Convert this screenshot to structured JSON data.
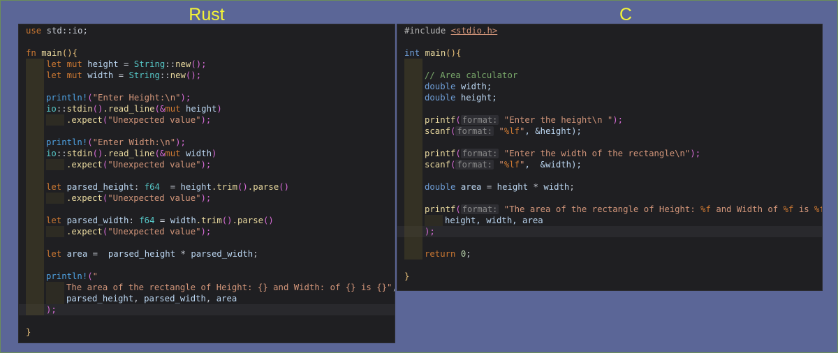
{
  "titles": {
    "rust": "Rust",
    "c": "C"
  },
  "rust": {
    "l1": {
      "a": "use",
      "b": " std::io;"
    },
    "l3": {
      "a": "fn",
      "b": " main",
      "c": "()",
      "d": "{"
    },
    "l4": {
      "a": "let mut",
      "b": " height",
      "c": " = ",
      "d": "String",
      "e": "::",
      "f": "new",
      "g": "();"
    },
    "l5": {
      "a": "let mut",
      "b": " width",
      "c": " = ",
      "d": "String",
      "e": "::",
      "f": "new",
      "g": "();"
    },
    "l7": {
      "a": "println!",
      "b": "(",
      "c": "\"Enter Height:\\n\"",
      "d": ");"
    },
    "l8": {
      "a": "io",
      "b": "::",
      "c": "stdin",
      "d": "()",
      "e": ".read_line",
      "f": "(&",
      "g": "mut",
      "h": " height",
      "i": ")"
    },
    "l9": {
      "a": ".expect",
      "b": "(",
      "c": "\"Unexpected value\"",
      "d": ");"
    },
    "l11": {
      "a": "println!",
      "b": "(",
      "c": "\"Enter Width:\\n\"",
      "d": ");"
    },
    "l12": {
      "a": "io",
      "b": "::",
      "c": "stdin",
      "d": "()",
      "e": ".read_line",
      "f": "(&",
      "g": "mut",
      "h": " width",
      "i": ")"
    },
    "l13": {
      "a": ".expect",
      "b": "(",
      "c": "\"Unexpected value\"",
      "d": ");"
    },
    "l15": {
      "a": "let",
      "b": " parsed_height",
      "c": ": ",
      "d": "f64",
      "e": "  = ",
      "f": "height",
      "g": ".trim",
      "h": "()",
      "i": ".parse",
      "j": "()"
    },
    "l16": {
      "a": ".expect",
      "b": "(",
      "c": "\"Unexpected value\"",
      "d": ");"
    },
    "l18": {
      "a": "let",
      "b": " parsed_width",
      "c": ": ",
      "d": "f64",
      "e": " = ",
      "f": "width",
      "g": ".trim",
      "h": "()",
      "i": ".parse",
      "j": "()"
    },
    "l19": {
      "a": ".expect",
      "b": "(",
      "c": "\"Unexpected value\"",
      "d": ");"
    },
    "l21": {
      "a": "let",
      "b": " area",
      "c": " =  ",
      "d": "parsed_height",
      "e": " * ",
      "f": "parsed_width",
      "g": ";"
    },
    "l23": {
      "a": "println!",
      "b": "(",
      "c": "\""
    },
    "l24": {
      "a": "The area of the rectangle of Height: {} and Width: of {} is {}\"",
      "b": ","
    },
    "l25": {
      "a": "parsed_height",
      "b": ", ",
      "c": "parsed_width",
      "d": ", ",
      "e": "area"
    },
    "l26": {
      "a": ");"
    },
    "l28": {
      "a": "}"
    }
  },
  "c": {
    "l1": {
      "a": "#include ",
      "b": "<stdio.h>"
    },
    "l3": {
      "a": "int",
      "b": " main",
      "c": "()",
      "d": "{"
    },
    "l5": {
      "a": "// Area calculator"
    },
    "l6": {
      "a": "double",
      "b": " width;"
    },
    "l7": {
      "a": "double",
      "b": " height;"
    },
    "l9": {
      "a": "printf",
      "b": "(",
      "c": "format:",
      "d": " \"Enter the height\\n \"",
      "e": ");"
    },
    "l10": {
      "a": "scanf",
      "b": "(",
      "c": "format:",
      "d": " \"",
      "e": "%lf",
      "f": "\"",
      "g": ", &height);"
    },
    "l12": {
      "a": "printf",
      "b": "(",
      "c": "format:",
      "d": " \"Enter the width of the rectangle\\n\"",
      "e": ");"
    },
    "l13": {
      "a": "scanf",
      "b": "(",
      "c": "format:",
      "d": " \"",
      "e": "%lf",
      "f": "\"",
      "g": ",  &width);"
    },
    "l15": {
      "a": "double",
      "b": " area",
      "c": " = ",
      "d": "height",
      "e": " * ",
      "f": "width",
      "g": ";"
    },
    "l17": {
      "a": "printf",
      "b": "(",
      "c": "format:",
      "d": " \"The area of the rectangle of Height: ",
      "e": "%f",
      "f": " and Width of ",
      "g": "%f",
      "h": " is ",
      "i": "%f",
      "j": "\","
    },
    "l18": {
      "a": "height, width, area"
    },
    "l19": {
      "a": ");"
    },
    "l21": {
      "a": "return",
      "b": " 0",
      "c": ";"
    },
    "l23": {
      "a": "}"
    }
  },
  "colors": {
    "background": "#5b6697",
    "editor_background": "#1f1f22",
    "title_color": "#f4f436"
  }
}
